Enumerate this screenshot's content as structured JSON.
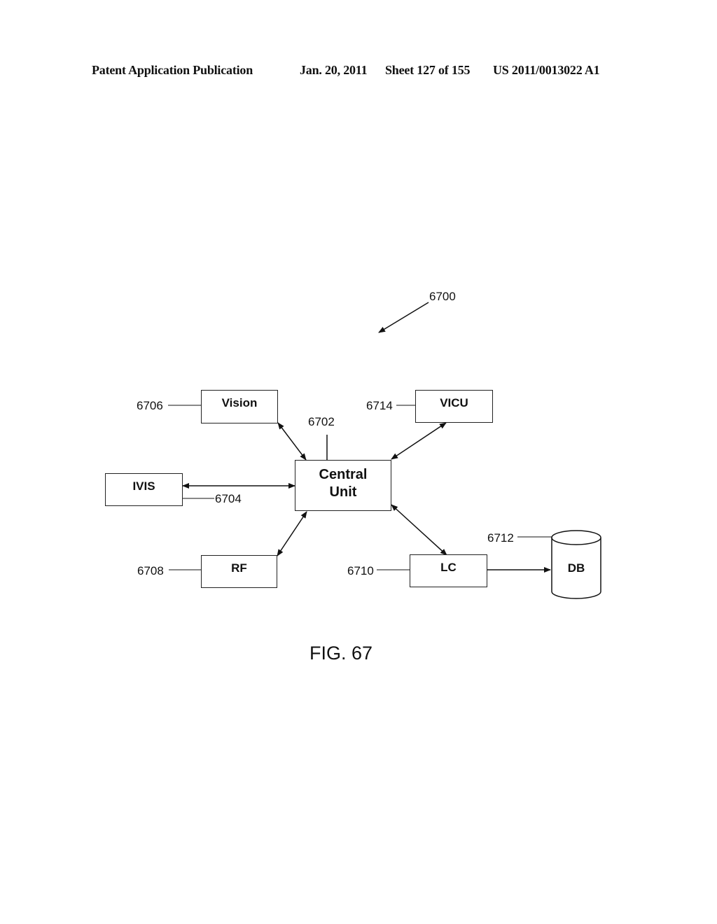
{
  "header": {
    "left": "Patent Application Publication",
    "date": "Jan. 20, 2011",
    "sheet": "Sheet 127 of 155",
    "number": "US 2011/0013022 A1"
  },
  "diagram": {
    "ref_system": "6700",
    "nodes": {
      "vision": {
        "label": "Vision",
        "ref": "6706"
      },
      "vicu": {
        "label": "VICU",
        "ref": "6714"
      },
      "central": {
        "label_line1": "Central",
        "label_line2": "Unit",
        "ref": "6702"
      },
      "ivis": {
        "label": "IVIS",
        "ref": "6704"
      },
      "rf": {
        "label": "RF",
        "ref": "6708"
      },
      "lc": {
        "label": "LC",
        "ref": "6710"
      },
      "db": {
        "label": "DB",
        "ref": "6712"
      }
    },
    "edges": [
      {
        "from": "vision",
        "to": "central",
        "type": "bidirectional"
      },
      {
        "from": "vicu",
        "to": "central",
        "type": "bidirectional"
      },
      {
        "from": "ivis",
        "to": "central",
        "type": "bidirectional"
      },
      {
        "from": "rf",
        "to": "central",
        "type": "bidirectional"
      },
      {
        "from": "lc",
        "to": "central",
        "type": "bidirectional"
      },
      {
        "from": "lc",
        "to": "db",
        "type": "directed"
      }
    ]
  },
  "caption": "FIG. 67"
}
